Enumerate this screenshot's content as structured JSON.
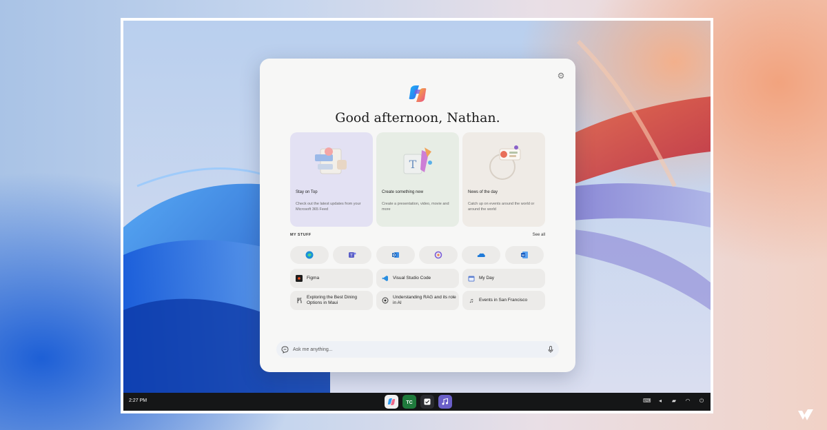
{
  "copilot": {
    "greeting": "Good afternoon, Nathan.",
    "cards": [
      {
        "title": "Stay on Top",
        "description": "Check out the latest updates from your Microsoft 365 Feed"
      },
      {
        "title": "Create something new",
        "description": "Create a presentation, video, movie and more"
      },
      {
        "title": "News of the day",
        "description": "Catch up on events around the world or around the world"
      }
    ],
    "my_stuff": {
      "label": "MY STUFF",
      "see_all": "See all",
      "apps": [
        "edge-icon",
        "teams-icon",
        "outlook-icon",
        "copilot-app-icon",
        "onedrive-icon",
        "word-icon"
      ],
      "items": [
        {
          "label": "Figma",
          "icon": "figma-icon"
        },
        {
          "label": "Visual Studio Code",
          "icon": "vscode-icon"
        },
        {
          "label": "My Day",
          "icon": "calendar-icon"
        },
        {
          "label": "Exploring the Best Dining Options in Maui",
          "icon": "dining-icon"
        },
        {
          "label": "Understanding RAG and its role in AI",
          "icon": "ai-icon"
        },
        {
          "label": "Events in San Francisco",
          "icon": "music-icon"
        }
      ]
    },
    "ask": {
      "placeholder": "Ask me anything..."
    }
  },
  "taskbar": {
    "time": "2:27 PM",
    "dock_apps": [
      "copilot-dock-icon",
      "terminal-dock-icon",
      "tasks-dock-icon",
      "music-dock-icon"
    ],
    "tray": [
      "keyboard-icon",
      "volume-icon",
      "folder-icon",
      "wifi-icon",
      "power-icon"
    ]
  },
  "colors": {
    "panel": "#f7f7f6",
    "taskbar": "#151617",
    "card_purple": "#e3e1f3",
    "card_green": "#e7ede5",
    "card_beige": "#efebe6"
  }
}
